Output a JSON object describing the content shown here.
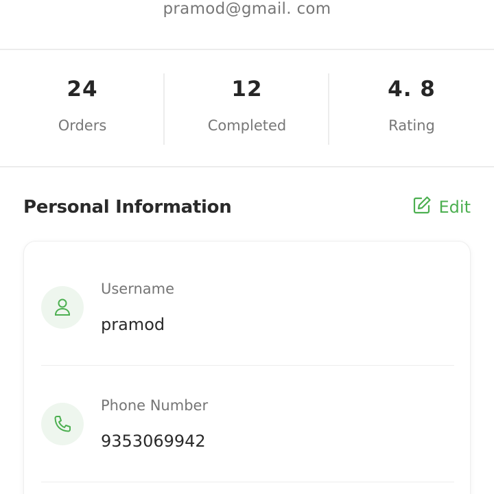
{
  "profile": {
    "email": "pramod@gmail. com"
  },
  "stats": [
    {
      "value": "24",
      "label": "Orders"
    },
    {
      "value": "12",
      "label": "Completed"
    },
    {
      "value": "4. 8",
      "label": "Rating"
    }
  ],
  "personal_info": {
    "title": "Personal Information",
    "edit_label": "Edit",
    "fields": [
      {
        "label": "Username",
        "value": "pramod",
        "icon": "user-icon"
      },
      {
        "label": "Phone Number",
        "value": "9353069942",
        "icon": "phone-icon"
      }
    ]
  },
  "colors": {
    "accent": "#4caf50",
    "icon_bg": "#eef6ee",
    "text_primary": "#2a2a2a",
    "text_secondary": "#777777",
    "divider": "#ececec"
  }
}
